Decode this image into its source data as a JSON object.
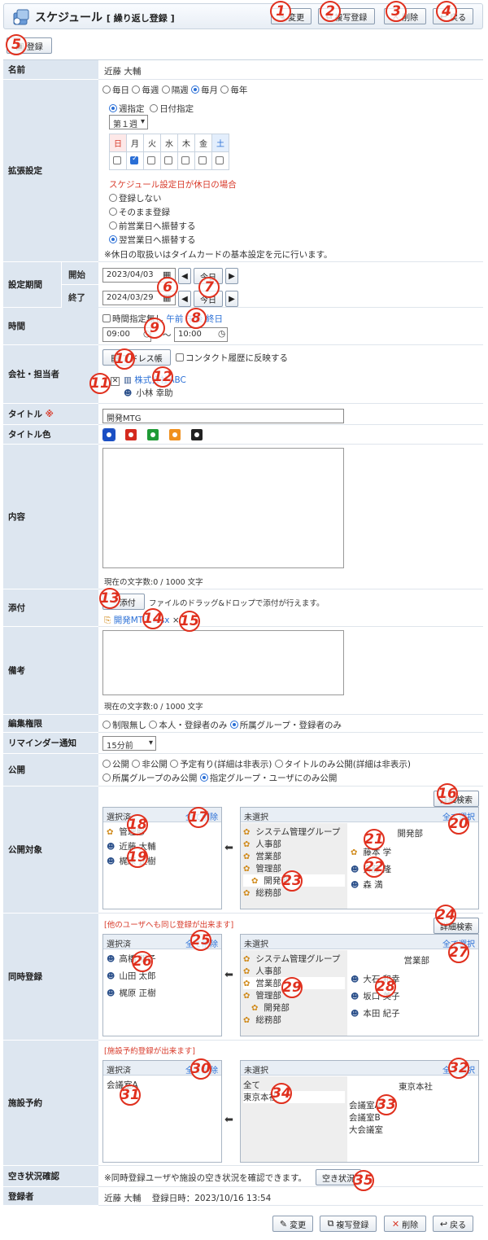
{
  "header": {
    "title": "スケジュール",
    "subtitle": "[ 繰り返し登録 ]"
  },
  "toolbar": {
    "edit": "変更",
    "copy": "複写登録",
    "delete": "削除",
    "back": "戻る",
    "register": "登録"
  },
  "markers": [
    "1",
    "2",
    "3",
    "4",
    "5",
    "6",
    "7",
    "8",
    "9",
    "10",
    "11",
    "12",
    "13",
    "14",
    "15",
    "16",
    "17",
    "18",
    "19",
    "20",
    "21",
    "22",
    "23",
    "24",
    "25",
    "26",
    "27",
    "28",
    "29",
    "30",
    "31",
    "32",
    "33",
    "34",
    "35"
  ],
  "labels": {
    "name": "名前",
    "ext": "拡張設定",
    "period": "設定期間",
    "start": "開始",
    "end": "終了",
    "time": "時間",
    "company": "会社・担当者",
    "title": "タイトル",
    "title_req": "※",
    "title_color": "タイトル色",
    "content": "内容",
    "attach": "添付",
    "memo": "備考",
    "edit_perm": "編集権限",
    "reminder": "リマインダー通知",
    "publish": "公開",
    "publish_target": "公開対象",
    "simul": "同時登録",
    "facility": "施設予約",
    "availability": "空き状況確認",
    "registrant": "登録者"
  },
  "name_value": "近藤 大輔",
  "ext": {
    "freq": [
      "毎日",
      "毎週",
      "隔週",
      "毎月",
      "毎年"
    ],
    "freq_selected": "毎月",
    "spec": [
      "週指定",
      "日付指定"
    ],
    "week_select": "第１週",
    "days": [
      "日",
      "月",
      "火",
      "水",
      "木",
      "金",
      "土"
    ],
    "days_checked": [
      false,
      true,
      false,
      false,
      false,
      false,
      false
    ],
    "holiday_title": "スケジュール設定日が休日の場合",
    "holiday_opts": [
      "登録しない",
      "そのまま登録",
      "前営業日へ振替する",
      "翌営業日へ振替する"
    ],
    "holiday_selected": "翌営業日へ振替する",
    "note": "※休日の取扱いはタイムカードの基本設定を元に行います。"
  },
  "period": {
    "start": "2023/04/03",
    "end": "2024/03/29",
    "today": "今日"
  },
  "time": {
    "nospec": "時間指定無し",
    "am": "午前",
    "pm": "午後",
    "allday": "終日",
    "from": "09:00",
    "tilde": "～",
    "to": "10:00"
  },
  "company": {
    "addrbook": "アドレス帳",
    "contact": "コンタクト履歴に反映する",
    "company_name": "株式会社ABC",
    "person": "小林 幸助"
  },
  "title_value": "開発MTG",
  "title_colors": [
    "#1a4fc4",
    "#d42a1e",
    "#1e9a35",
    "#f0901e",
    "#222222"
  ],
  "content": {
    "count": "現在の文字数:0 / 1000 文字"
  },
  "attach": {
    "button": "添付",
    "hint": "ファイルのドラッグ&ドロップで添付が行えます。",
    "file": "開発MTG.xlsx",
    "remove": "×"
  },
  "memo": {
    "count": "現在の文字数:0 / 1000 文字"
  },
  "edit_perm": {
    "opts": [
      "制限無し",
      "本人・登録者のみ",
      "所属グループ・登録者のみ"
    ],
    "selected": "所属グループ・登録者のみ"
  },
  "reminder": {
    "value": "15分前"
  },
  "publish": {
    "opts1": [
      "公開",
      "非公開",
      "予定有り(詳細は非表示)",
      "タイトルのみ公開(詳細は非表示)"
    ],
    "opts2": [
      "所属グループのみ公開",
      "指定グループ・ユーザにのみ公開"
    ],
    "selected": "指定グループ・ユーザにのみ公開"
  },
  "target": {
    "search": "詳細検索",
    "selected_hdr": "選択済",
    "remove_all": "全て削除",
    "unselected_hdr": "未選択",
    "select_all": "全て選択",
    "selected": [
      "管理部",
      "近藤 大輔",
      "梶原 正樹"
    ],
    "groups": [
      "システム管理グループ",
      "人事部",
      "営業部",
      "管理部",
      "開発部",
      "総務部"
    ],
    "users_hdr": "開発部",
    "users": [
      "藤本 学",
      "斉藤 隆",
      "森 満"
    ]
  },
  "simul": {
    "note": "[他のユーザへも同じ登録が出来ます]",
    "search": "詳細検索",
    "selected_hdr": "選択済",
    "remove_all": "全て削除",
    "unselected_hdr": "未選択",
    "select_all": "全て選択",
    "selected": [
      "高橋 明子",
      "山田 太郎",
      "梶原 正樹"
    ],
    "groups": [
      "システム管理グループ",
      "人事部",
      "営業部",
      "管理部",
      "開発部",
      "総務部"
    ],
    "users_hdr": "営業部",
    "users": [
      "大石 和幸",
      "坂口 美子",
      "本田 紀子"
    ]
  },
  "facility": {
    "note": "[施設予約登録が出来ます]",
    "selected_hdr": "選択済",
    "remove_all": "全て削除",
    "unselected_hdr": "未選択",
    "select_all": "全て選択",
    "selected": [
      "会議室A"
    ],
    "groups": [
      "全て",
      "東京本社"
    ],
    "fac_hdr": "東京本社",
    "facilities": [
      "会議室A",
      "会議室B",
      "大会議室"
    ]
  },
  "availability": {
    "note": "※同時登録ユーザや施設の空き状況を確認できます。",
    "button": "空き状況"
  },
  "registrant": {
    "name": "近藤 大輔",
    "date": "登録日時：2023/10/16 13:54"
  }
}
